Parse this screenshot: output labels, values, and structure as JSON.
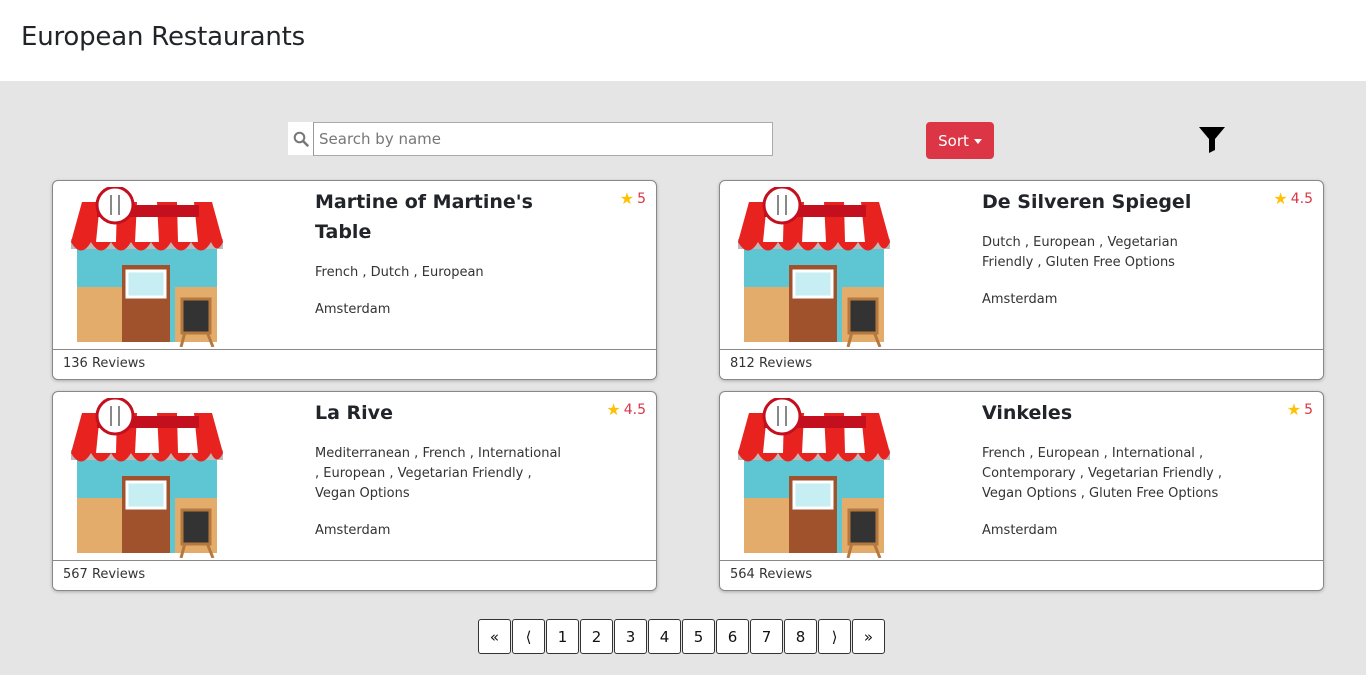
{
  "header": {
    "title": "European Restaurants"
  },
  "search": {
    "placeholder": "Search by name",
    "value": ""
  },
  "sort": {
    "label": "Sort"
  },
  "restaurants": [
    {
      "name": "Martine of Martine's Table",
      "rating": "5",
      "cuisines": "French , Dutch , European",
      "city": "Amsterdam",
      "reviews": "136 Reviews"
    },
    {
      "name": "De Silveren Spiegel",
      "rating": "4.5",
      "cuisines": "Dutch , European , Vegetarian Friendly , Gluten Free Options",
      "city": "Amsterdam",
      "reviews": "812 Reviews"
    },
    {
      "name": "La Rive",
      "rating": "4.5",
      "cuisines": "Mediterranean , French , International , European , Vegetarian Friendly , Vegan Options",
      "city": "Amsterdam",
      "reviews": "567 Reviews"
    },
    {
      "name": "Vinkeles",
      "rating": "5",
      "cuisines": "French , European , International , Contemporary , Vegetarian Friendly , Vegan Options , Gluten Free Options",
      "city": "Amsterdam",
      "reviews": "564 Reviews"
    }
  ],
  "pagination": {
    "first": "«",
    "prev": "⟨",
    "pages": [
      "1",
      "2",
      "3",
      "4",
      "5",
      "6",
      "7",
      "8"
    ],
    "next": "⟩",
    "last": "»"
  },
  "colors": {
    "accent": "#dc3545",
    "star": "#ffc107",
    "background": "#e5e5e5"
  }
}
